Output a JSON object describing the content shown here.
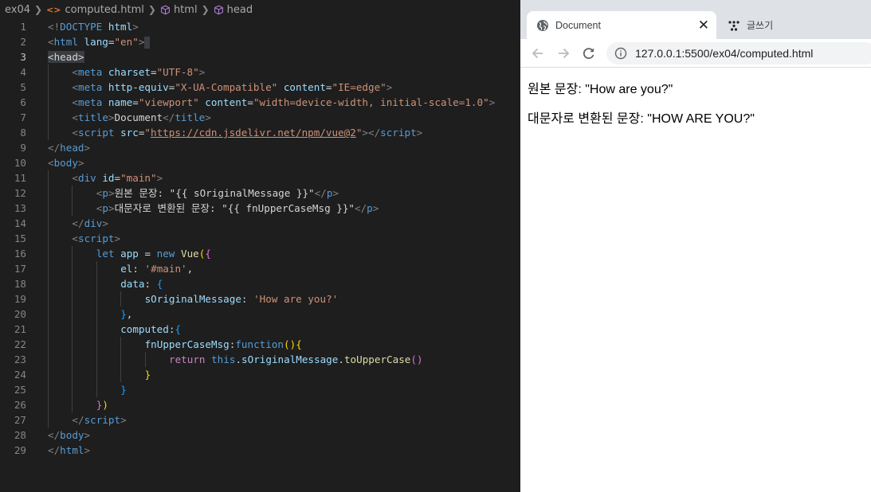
{
  "editor": {
    "breadcrumb": [
      "ex04",
      "computed.html",
      "html",
      "head"
    ],
    "lines": [
      {
        "n": "1",
        "indent": 0,
        "tokens": [
          [
            "br",
            "<!"
          ],
          [
            "tag",
            "DOCTYPE"
          ],
          [
            "txt",
            " "
          ],
          [
            "attr",
            "html"
          ],
          [
            "br",
            ">"
          ]
        ]
      },
      {
        "n": "2",
        "indent": 0,
        "tokens": [
          [
            "br",
            "<"
          ],
          [
            "tag",
            "html"
          ],
          [
            "txt",
            " "
          ],
          [
            "attr",
            "lang"
          ],
          [
            "txt",
            "="
          ],
          [
            "str",
            "\"en\""
          ],
          [
            "br",
            ">"
          ],
          [
            "cursor",
            ""
          ]
        ]
      },
      {
        "n": "3",
        "indent": 0,
        "active": true,
        "tokens": [
          [
            "hl",
            "<head>"
          ]
        ]
      },
      {
        "n": "4",
        "indent": 1,
        "tokens": [
          [
            "br",
            "<"
          ],
          [
            "tag",
            "meta"
          ],
          [
            "txt",
            " "
          ],
          [
            "attr",
            "charset"
          ],
          [
            "txt",
            "="
          ],
          [
            "str",
            "\"UTF-8\""
          ],
          [
            "br",
            ">"
          ]
        ]
      },
      {
        "n": "5",
        "indent": 1,
        "tokens": [
          [
            "br",
            "<"
          ],
          [
            "tag",
            "meta"
          ],
          [
            "txt",
            " "
          ],
          [
            "attr",
            "http-equiv"
          ],
          [
            "txt",
            "="
          ],
          [
            "str",
            "\"X-UA-Compatible\""
          ],
          [
            "txt",
            " "
          ],
          [
            "attr",
            "content"
          ],
          [
            "txt",
            "="
          ],
          [
            "str",
            "\"IE=edge\""
          ],
          [
            "br",
            ">"
          ]
        ]
      },
      {
        "n": "6",
        "indent": 1,
        "tokens": [
          [
            "br",
            "<"
          ],
          [
            "tag",
            "meta"
          ],
          [
            "txt",
            " "
          ],
          [
            "attr",
            "name"
          ],
          [
            "txt",
            "="
          ],
          [
            "str",
            "\"viewport\""
          ],
          [
            "txt",
            " "
          ],
          [
            "attr",
            "content"
          ],
          [
            "txt",
            "="
          ],
          [
            "str",
            "\"width=device-width, initial-scale=1.0\""
          ],
          [
            "br",
            ">"
          ]
        ]
      },
      {
        "n": "7",
        "indent": 1,
        "tokens": [
          [
            "br",
            "<"
          ],
          [
            "tag",
            "title"
          ],
          [
            "br",
            ">"
          ],
          [
            "txt",
            "Document"
          ],
          [
            "br",
            "</"
          ],
          [
            "tag",
            "title"
          ],
          [
            "br",
            ">"
          ]
        ]
      },
      {
        "n": "8",
        "indent": 1,
        "tokens": [
          [
            "br",
            "<"
          ],
          [
            "tag",
            "script"
          ],
          [
            "txt",
            " "
          ],
          [
            "attr",
            "src"
          ],
          [
            "txt",
            "="
          ],
          [
            "str",
            "\""
          ],
          [
            "url",
            "https://cdn.jsdelivr.net/npm/vue@2"
          ],
          [
            "str",
            "\""
          ],
          [
            "br",
            "></"
          ],
          [
            "tag",
            "script"
          ],
          [
            "br",
            ">"
          ]
        ]
      },
      {
        "n": "9",
        "indent": 0,
        "tokens": [
          [
            "br",
            "</"
          ],
          [
            "tag",
            "head"
          ],
          [
            "br",
            ">"
          ]
        ]
      },
      {
        "n": "10",
        "indent": 0,
        "tokens": [
          [
            "br",
            "<"
          ],
          [
            "tag",
            "body"
          ],
          [
            "br",
            ">"
          ]
        ]
      },
      {
        "n": "11",
        "indent": 1,
        "tokens": [
          [
            "br",
            "<"
          ],
          [
            "tag",
            "div"
          ],
          [
            "txt",
            " "
          ],
          [
            "attr",
            "id"
          ],
          [
            "txt",
            "="
          ],
          [
            "str",
            "\"main\""
          ],
          [
            "br",
            ">"
          ]
        ]
      },
      {
        "n": "12",
        "indent": 2,
        "tokens": [
          [
            "br",
            "<"
          ],
          [
            "tag",
            "p"
          ],
          [
            "br",
            ">"
          ],
          [
            "txt",
            "원본 문장: \"{{ sOriginalMessage }}\""
          ],
          [
            "br",
            "</"
          ],
          [
            "tag",
            "p"
          ],
          [
            "br",
            ">"
          ]
        ]
      },
      {
        "n": "13",
        "indent": 2,
        "tokens": [
          [
            "br",
            "<"
          ],
          [
            "tag",
            "p"
          ],
          [
            "br",
            ">"
          ],
          [
            "txt",
            "대문자로 변환된 문장: \"{{ fnUpperCaseMsg }}\""
          ],
          [
            "br",
            "</"
          ],
          [
            "tag",
            "p"
          ],
          [
            "br",
            ">"
          ]
        ]
      },
      {
        "n": "14",
        "indent": 1,
        "tokens": [
          [
            "br",
            "</"
          ],
          [
            "tag",
            "div"
          ],
          [
            "br",
            ">"
          ]
        ]
      },
      {
        "n": "15",
        "indent": 1,
        "tokens": [
          [
            "br",
            "<"
          ],
          [
            "tag",
            "script"
          ],
          [
            "br",
            ">"
          ]
        ]
      },
      {
        "n": "16",
        "indent": 2,
        "tokens": [
          [
            "kw",
            "let"
          ],
          [
            "txt",
            " "
          ],
          [
            "prop",
            "app"
          ],
          [
            "txt",
            " = "
          ],
          [
            "kw",
            "new"
          ],
          [
            "txt",
            " "
          ],
          [
            "fn",
            "Vue"
          ],
          [
            "b1",
            "("
          ],
          [
            "b2",
            "{"
          ]
        ]
      },
      {
        "n": "17",
        "indent": 3,
        "tokens": [
          [
            "prop",
            "el"
          ],
          [
            "txt",
            ": "
          ],
          [
            "str",
            "'#main'"
          ],
          [
            "txt",
            ","
          ]
        ]
      },
      {
        "n": "18",
        "indent": 3,
        "tokens": [
          [
            "prop",
            "data"
          ],
          [
            "txt",
            ": "
          ],
          [
            "b3",
            "{"
          ]
        ]
      },
      {
        "n": "19",
        "indent": 4,
        "tokens": [
          [
            "prop",
            "sOriginalMessage"
          ],
          [
            "txt",
            ": "
          ],
          [
            "str",
            "'How are you?'"
          ]
        ]
      },
      {
        "n": "20",
        "indent": 3,
        "tokens": [
          [
            "b3",
            "}"
          ],
          [
            "txt",
            ","
          ]
        ]
      },
      {
        "n": "21",
        "indent": 3,
        "tokens": [
          [
            "prop",
            "computed"
          ],
          [
            "txt",
            ":"
          ],
          [
            "b3",
            "{"
          ]
        ]
      },
      {
        "n": "22",
        "indent": 4,
        "tokens": [
          [
            "prop",
            "fnUpperCaseMsg"
          ],
          [
            "txt",
            ":"
          ],
          [
            "kw",
            "function"
          ],
          [
            "b1",
            "()"
          ],
          [
            "b1",
            "{"
          ]
        ]
      },
      {
        "n": "23",
        "indent": 5,
        "tokens": [
          [
            "ctrl",
            "return"
          ],
          [
            "txt",
            " "
          ],
          [
            "kw",
            "this"
          ],
          [
            "txt",
            "."
          ],
          [
            "prop",
            "sOriginalMessage"
          ],
          [
            "txt",
            "."
          ],
          [
            "fn",
            "toUpperCase"
          ],
          [
            "b2",
            "()"
          ]
        ]
      },
      {
        "n": "24",
        "indent": 4,
        "tokens": [
          [
            "b1",
            "}"
          ]
        ]
      },
      {
        "n": "25",
        "indent": 3,
        "tokens": [
          [
            "b3",
            "}"
          ]
        ]
      },
      {
        "n": "26",
        "indent": 2,
        "tokens": [
          [
            "b2",
            "}"
          ],
          [
            "b1",
            ")"
          ]
        ]
      },
      {
        "n": "27",
        "indent": 1,
        "tokens": [
          [
            "br",
            "</"
          ],
          [
            "tag",
            "script"
          ],
          [
            "br",
            ">"
          ]
        ]
      },
      {
        "n": "28",
        "indent": 0,
        "tokens": [
          [
            "br",
            "</"
          ],
          [
            "tag",
            "body"
          ],
          [
            "br",
            ">"
          ]
        ]
      },
      {
        "n": "29",
        "indent": 0,
        "tokens": [
          [
            "br",
            "</"
          ],
          [
            "tag",
            "html"
          ],
          [
            "br",
            ">"
          ]
        ]
      }
    ]
  },
  "browser": {
    "tabs": [
      {
        "label": "Document",
        "icon": "globe-icon",
        "active": true,
        "close": "✕"
      },
      {
        "label": "글쓰기",
        "icon": "dots-icon",
        "active": false
      }
    ],
    "url": "127.0.0.1:5500/ex04/computed.html",
    "content": {
      "line1": "원본 문장: \"How are you?\"",
      "line2": "대문자로 변환된 문장: \"HOW ARE YOU?\""
    }
  }
}
